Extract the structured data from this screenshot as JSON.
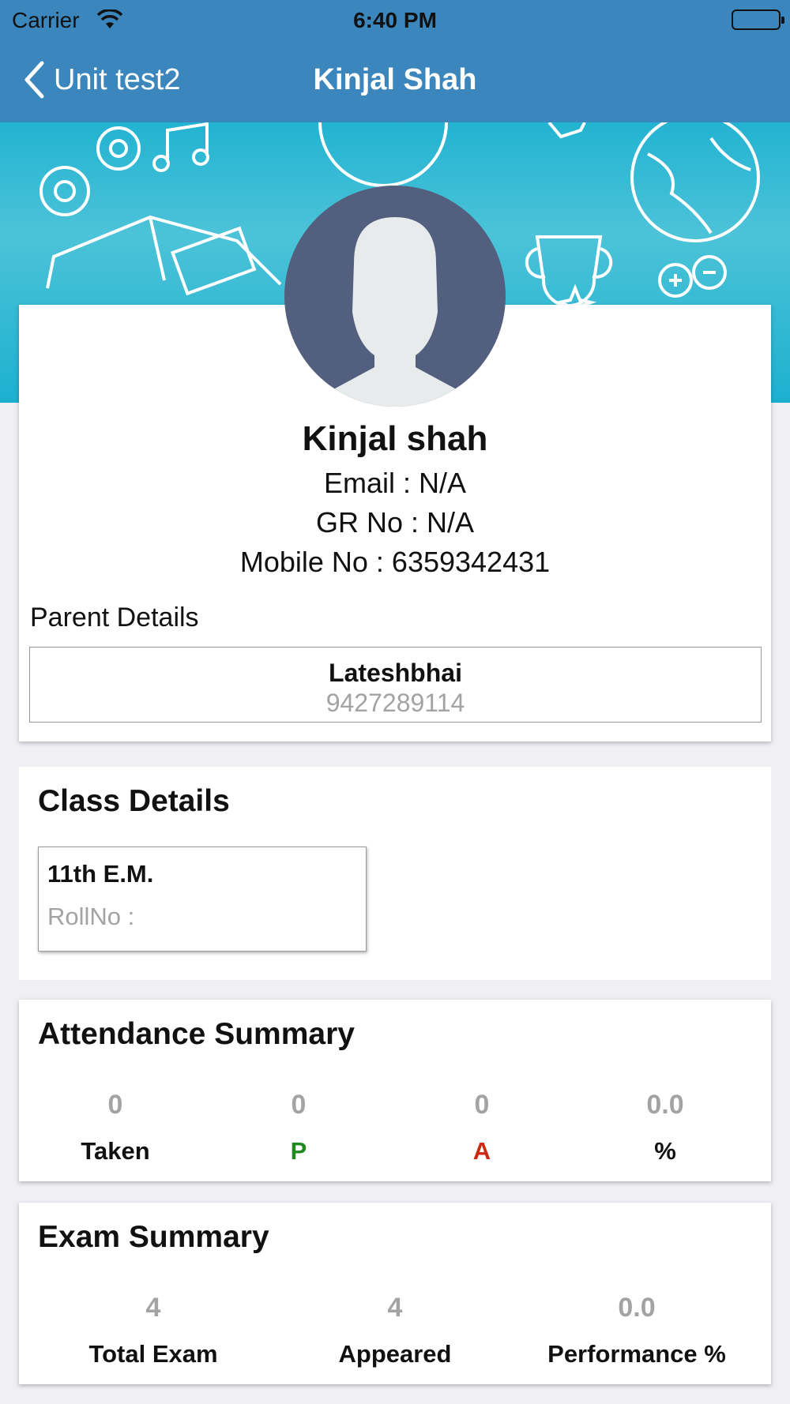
{
  "status_bar": {
    "carrier": "Carrier",
    "time": "6:40 PM"
  },
  "nav": {
    "back_label": "Unit test2",
    "title": "Kinjal Shah"
  },
  "profile": {
    "name": "Kinjal shah",
    "email": "Email :  N/A",
    "gr_no": "GR No :  N/A",
    "mobile": "Mobile No :  6359342431"
  },
  "parent": {
    "section_title": "Parent Details",
    "name": "Lateshbhai",
    "phone": "9427289114"
  },
  "class_details": {
    "section_title": "Class Details",
    "class_name": "11th E.M.",
    "roll_no": "RollNo :"
  },
  "attendance": {
    "section_title": "Attendance Summary",
    "items": [
      {
        "value": "0",
        "label": "Taken",
        "color": "#111111"
      },
      {
        "value": "0",
        "label": "P",
        "color": "#1f8a1f"
      },
      {
        "value": "0",
        "label": "A",
        "color": "#cc2a12"
      },
      {
        "value": "0.0",
        "label": "%",
        "color": "#111111"
      }
    ]
  },
  "exam": {
    "section_title": "Exam Summary",
    "items": [
      {
        "value": "4",
        "label": "Total Exam"
      },
      {
        "value": "4",
        "label": "Appeared"
      },
      {
        "value": "0.0",
        "label": "Performance %"
      }
    ]
  },
  "colors": {
    "nav_bar": "#3a86bd",
    "banner": "#22b3d2",
    "avatar_bg": "#535f7e"
  }
}
